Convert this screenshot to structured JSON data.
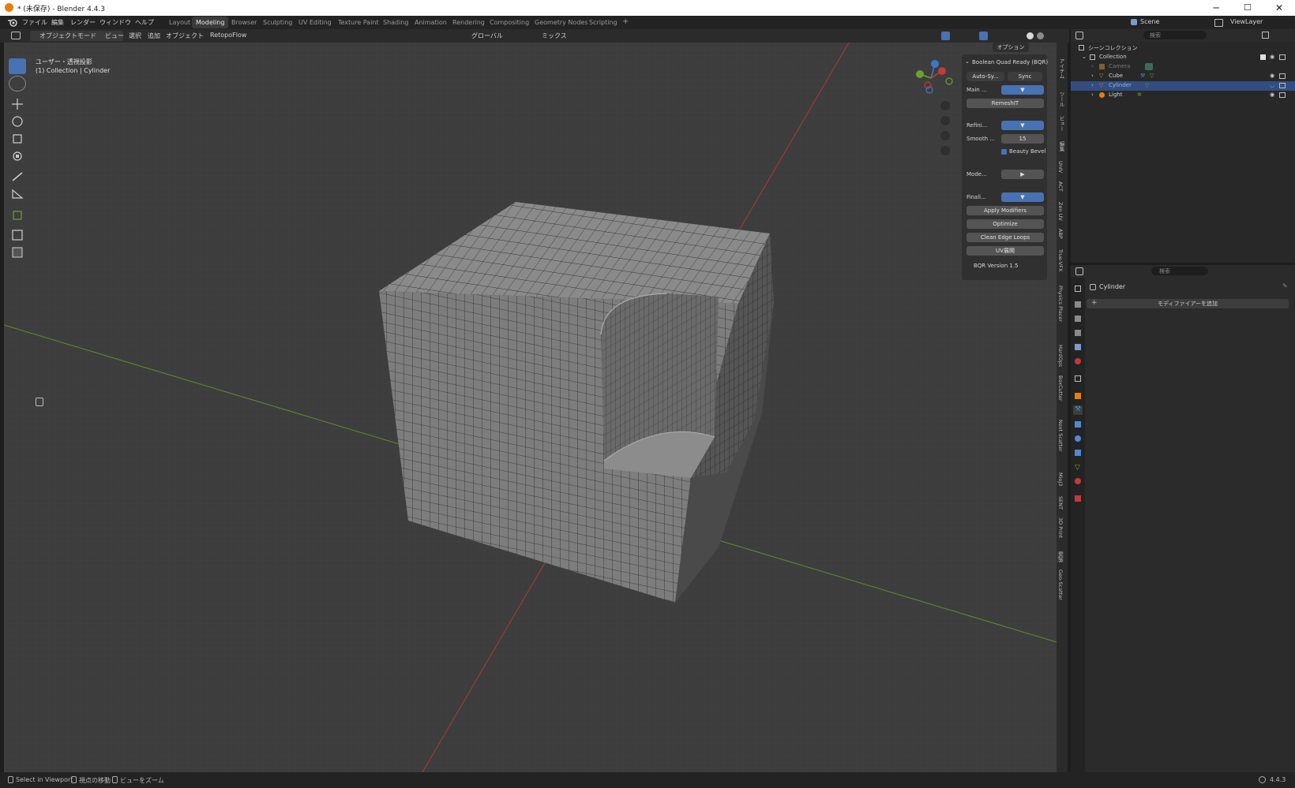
{
  "window": {
    "title": "* (未保存) - Blender 4.4.3",
    "minimize": "─",
    "maximize": "☐",
    "close": "✕"
  },
  "menubar": {
    "items": [
      "ファイル",
      "編集",
      "レンダー",
      "ウィンドウ",
      "ヘルプ"
    ],
    "workspaces": [
      "Layout",
      "Modeling",
      "Browser",
      "Sculpting",
      "UV Editing",
      "Texture Paint",
      "Shading",
      "Animation",
      "Rendering",
      "Compositing",
      "Geometry Nodes",
      "Scripting"
    ],
    "active_workspace": "Modeling",
    "add_tab": "+",
    "scene": "Scene",
    "view_layer": "ViewLayer"
  },
  "header": {
    "mode": "オブジェクトモード",
    "menus": [
      "ビュー",
      "選択",
      "追加",
      "オブジェクト"
    ],
    "addon": "RetopoFlow",
    "transform_orientation": "グローバル",
    "snapping": "ミックス",
    "options": "オプション"
  },
  "viewport": {
    "view_name": "ユーザー・透視投影",
    "collection_info": "(1) Collection | Cylinder"
  },
  "npanel": {
    "title": "Boolean Quad Ready (BQR)",
    "auto_sync": "Auto-Sy...",
    "sync": "Sync",
    "main_label": "Main ...",
    "remesh": "RemeshIT",
    "refine_label": "Refini...",
    "smooth_label": "Smooth ...",
    "smooth_value": "15",
    "beauty_bevel": "Beauty Bevel",
    "modes_label": "Mode...",
    "finalize_label": "Finali...",
    "apply_modifiers": "Apply Modifiers",
    "optimize": "Optimize",
    "clean_edge_loops": "Clean Edge Loops",
    "uv_unwrap": "UV展開",
    "version": "BQR Version 1.5"
  },
  "side_tabs": [
    "アイテム",
    "ツール",
    "ビュー",
    "編集",
    "UnIV",
    "ACT",
    "Zen UV",
    "ABP",
    "True-VFX",
    "Physics Placer",
    "HardOps",
    "BoxCutter",
    "Next Scatter",
    "MioJ3",
    "SENT",
    "3D Print",
    "BQR",
    "Geo-Scatter"
  ],
  "outliner": {
    "search_placeholder": "検索",
    "scene_collection": "シーンコレクション",
    "collection": "Collection",
    "objects": [
      "Camera",
      "Cube",
      "Cylinder",
      "Light"
    ],
    "selected": "Cylinder"
  },
  "properties": {
    "search_placeholder": "検索",
    "object_name": "Cylinder",
    "add_modifier": "モディファイアーを追加"
  },
  "statusbar": {
    "select": "Select in Viewport",
    "rotate": "視点の移動",
    "zoom": "ビューをズーム",
    "version": "4.4.3"
  },
  "colors": {
    "accent": "#4772b3",
    "x_axis": "#c13b3b",
    "y_axis": "#6ea02e",
    "z_axis": "#3a78c8",
    "orange": "#e87d0d",
    "mesh": "#808080"
  }
}
